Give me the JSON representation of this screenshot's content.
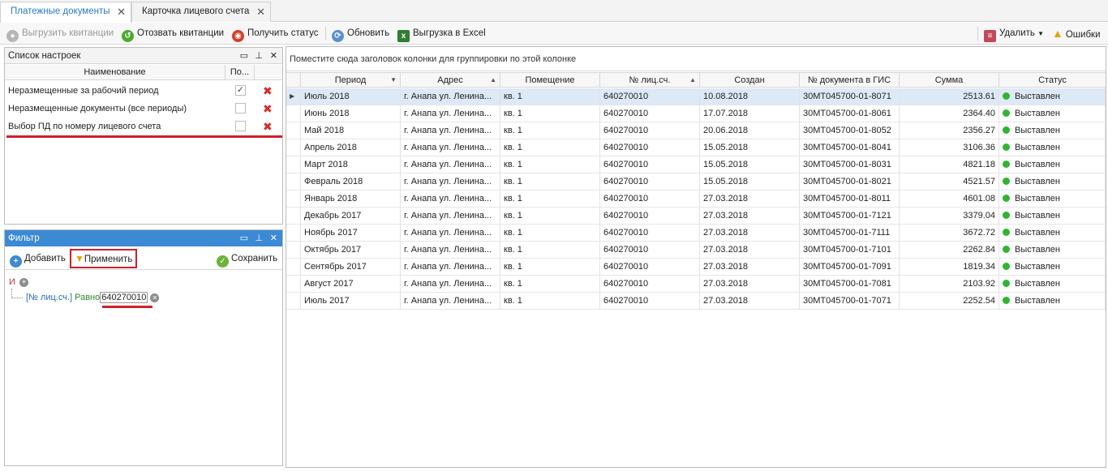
{
  "tabs": [
    {
      "label": "Платежные документы",
      "active": true
    },
    {
      "label": "Карточка лицевого счета",
      "active": false
    }
  ],
  "toolbar": {
    "unload_receipts": "Выгрузить квитанции",
    "recall_receipts": "Отозвать квитанции",
    "get_status": "Получить статус",
    "refresh": "Обновить",
    "export_excel": "Выгрузка в Excel",
    "delete": "Удалить",
    "errors": "Ошибки"
  },
  "settings_panel": {
    "title": "Список настроек",
    "col_name": "Наименование",
    "col_flag": "По...",
    "items": [
      {
        "name": "Неразмещенные за рабочий период",
        "checked": true
      },
      {
        "name": "Неразмещенные документы (все периоды)",
        "checked": false
      },
      {
        "name": "Выбор ПД по номеру лицевого счета",
        "checked": false
      }
    ]
  },
  "filter_panel": {
    "title": "Фильтр",
    "add": "Добавить",
    "apply": "Применить",
    "save": "Сохранить",
    "group_op": "И",
    "field": "[№ лиц.сч.]",
    "operator": "Равно",
    "value": "640270010"
  },
  "grid": {
    "group_hint": "Поместите сюда заголовок колонки для группировки по этой колонке",
    "columns": [
      "Период",
      "Адрес",
      "Помещение",
      "№ лиц.сч.",
      "Создан",
      "№ документа в ГИС",
      "Сумма",
      "Статус"
    ],
    "rows": [
      [
        "Июль 2018",
        "г. Анапа ул. Ленина...",
        "кв. 1",
        "640270010",
        "10.08.2018",
        "30МТ045700-01-8071",
        "2513.61",
        "Выставлен"
      ],
      [
        "Июнь 2018",
        "г. Анапа ул. Ленина...",
        "кв. 1",
        "640270010",
        "17.07.2018",
        "30МТ045700-01-8061",
        "2364.40",
        "Выставлен"
      ],
      [
        "Май 2018",
        "г. Анапа ул. Ленина...",
        "кв. 1",
        "640270010",
        "20.06.2018",
        "30МТ045700-01-8052",
        "2356.27",
        "Выставлен"
      ],
      [
        "Апрель 2018",
        "г. Анапа ул. Ленина...",
        "кв. 1",
        "640270010",
        "15.05.2018",
        "30МТ045700-01-8041",
        "3106.36",
        "Выставлен"
      ],
      [
        "Март 2018",
        "г. Анапа ул. Ленина...",
        "кв. 1",
        "640270010",
        "15.05.2018",
        "30МТ045700-01-8031",
        "4821.18",
        "Выставлен"
      ],
      [
        "Февраль 2018",
        "г. Анапа ул. Ленина...",
        "кв. 1",
        "640270010",
        "15.05.2018",
        "30МТ045700-01-8021",
        "4521.57",
        "Выставлен"
      ],
      [
        "Январь 2018",
        "г. Анапа ул. Ленина...",
        "кв. 1",
        "640270010",
        "27.03.2018",
        "30МТ045700-01-8011",
        "4601.08",
        "Выставлен"
      ],
      [
        "Декабрь 2017",
        "г. Анапа ул. Ленина...",
        "кв. 1",
        "640270010",
        "27.03.2018",
        "30МТ045700-01-7121",
        "3379.04",
        "Выставлен"
      ],
      [
        "Ноябрь 2017",
        "г. Анапа ул. Ленина...",
        "кв. 1",
        "640270010",
        "27.03.2018",
        "30МТ045700-01-7111",
        "3672.72",
        "Выставлен"
      ],
      [
        "Октябрь 2017",
        "г. Анапа ул. Ленина...",
        "кв. 1",
        "640270010",
        "27.03.2018",
        "30МТ045700-01-7101",
        "2262.84",
        "Выставлен"
      ],
      [
        "Сентябрь 2017",
        "г. Анапа ул. Ленина...",
        "кв. 1",
        "640270010",
        "27.03.2018",
        "30МТ045700-01-7091",
        "1819.34",
        "Выставлен"
      ],
      [
        "Август 2017",
        "г. Анапа ул. Ленина...",
        "кв. 1",
        "640270010",
        "27.03.2018",
        "30МТ045700-01-7081",
        "2103.92",
        "Выставлен"
      ],
      [
        "Июль 2017",
        "г. Анапа ул. Ленина...",
        "кв. 1",
        "640270010",
        "27.03.2018",
        "30МТ045700-01-7071",
        "2252.54",
        "Выставлен"
      ]
    ]
  },
  "colors": {
    "accent": "#3c8ad3",
    "highlight": "#d0202a",
    "status_ok": "#2fb52f"
  }
}
